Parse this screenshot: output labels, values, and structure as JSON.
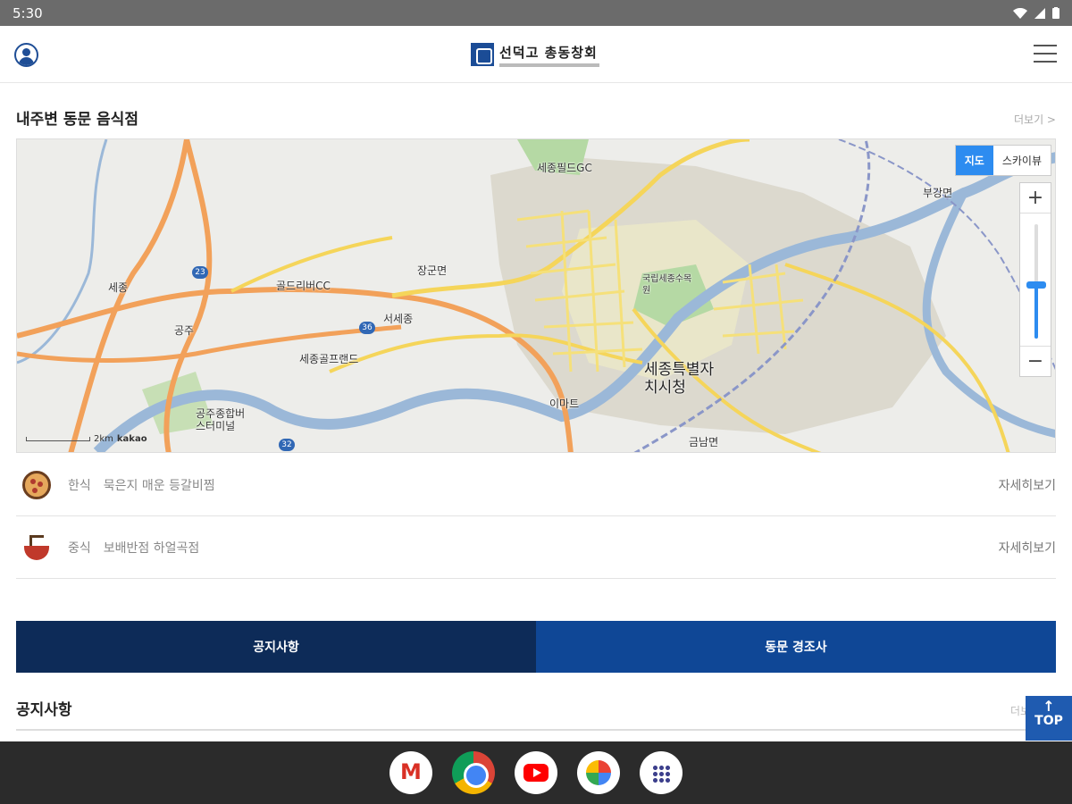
{
  "status_bar": {
    "time": "5:30"
  },
  "header": {
    "logo_text": "선덕고 총동창회"
  },
  "restaurants_section": {
    "title": "내주변 동문 음식점",
    "more": "더보기 >",
    "map": {
      "mode_map": "지도",
      "mode_skyview": "스카이뷰",
      "zoom_in": "+",
      "zoom_out": "−",
      "zoom_level": 0.5,
      "scale": "2km",
      "attribution": "kakao",
      "labels": [
        "세종필드GC",
        "장군면",
        "골드리버CC",
        "서세종",
        "세종골프랜드",
        "공주",
        "공주종합버스터미널",
        "세종특별자치시청",
        "국립세종수목원",
        "금남면",
        "부강면",
        "이마트",
        "세종"
      ],
      "road_shields": [
        "23",
        "36",
        "32"
      ]
    },
    "items": [
      {
        "category": "한식",
        "name": "묵은지 매운 등갈비찜",
        "detail": "자세히보기",
        "icon": "pizza-icon"
      },
      {
        "category": "중식",
        "name": "보배반점 하얼곡점",
        "detail": "자세히보기",
        "icon": "noodle-bowl-icon"
      }
    ]
  },
  "tabs": [
    {
      "label": "공지사항",
      "active": true
    },
    {
      "label": "동문 경조사",
      "active": false
    }
  ],
  "notice_section": {
    "title": "공지사항",
    "more": "더보"
  },
  "top_button": {
    "arrow": "↑",
    "label": "TOP"
  },
  "dock": [
    "gmail-icon",
    "chrome-icon",
    "youtube-icon",
    "photos-icon",
    "app-drawer-icon"
  ]
}
